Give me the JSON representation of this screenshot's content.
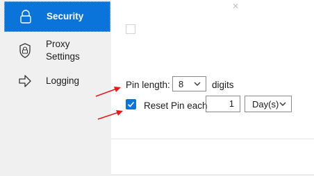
{
  "sidebar": {
    "items": [
      {
        "label": "Security",
        "icon": "lock-icon"
      },
      {
        "label": "Proxy\nSettings",
        "icon": "shield-lock-icon"
      },
      {
        "label": "Logging",
        "icon": "arrow-right-icon"
      }
    ]
  },
  "pin": {
    "label": "Pin length:",
    "value": "8",
    "suffix": "digits"
  },
  "reset": {
    "label": "Reset Pin each",
    "checked": true,
    "value": "1",
    "unit": "Day(s)"
  },
  "colors": {
    "accent": "#0a74da",
    "annotation_arrow": "#e31b1b",
    "sidebar_bg": "#f0f0f0"
  }
}
